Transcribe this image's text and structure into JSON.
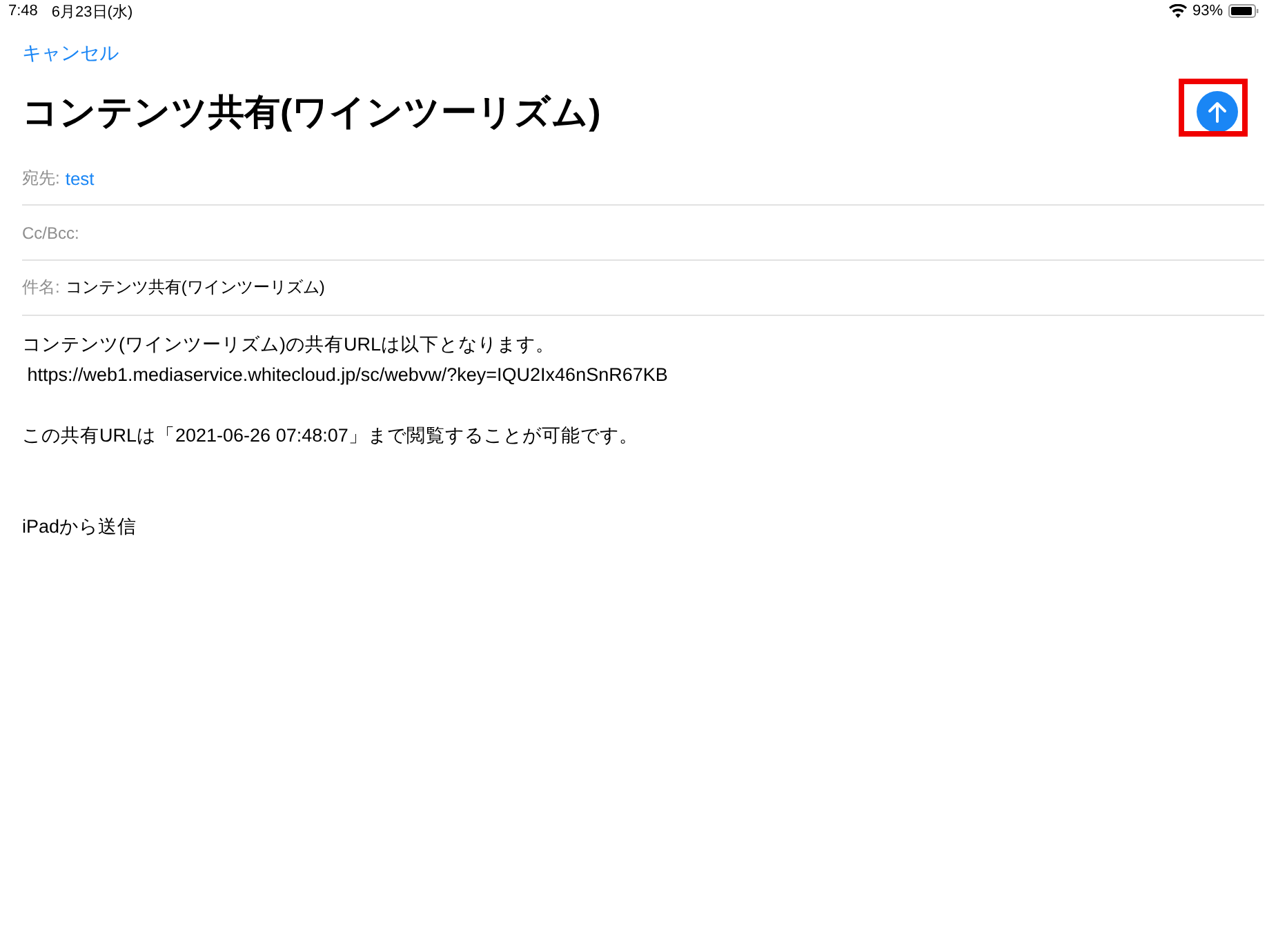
{
  "status_bar": {
    "time": "7:48",
    "date": "6月23日(水)",
    "battery_percent": "93%"
  },
  "nav": {
    "cancel": "キャンセル"
  },
  "title": "コンテンツ共有(ワインツーリズム)",
  "send_button": {
    "highlighted": true
  },
  "fields": [
    {
      "label": "宛先:",
      "value": "test",
      "kind": "recipient"
    },
    {
      "label": "Cc/Bcc:",
      "kind": "recipient"
    },
    {
      "label": "件名:",
      "value": "コンテンツ共有(ワインツーリズム)",
      "kind": "subject"
    }
  ],
  "body": [
    {
      "kind": "paragraph",
      "lines": [
        "コンテンツ(ワインツーリズム)の共有URLは以下となります。",
        " https://web1.mediaservice.whitecloud.jp/sc/webvw/?key=IQU2Ix46nSnR67KB"
      ]
    },
    {
      "kind": "paragraph",
      "lines": [
        "この共有URLは「2021-06-26 07:48:07」まで閲覧することが可能です。"
      ]
    },
    {
      "kind": "signature",
      "lines": [
        "iPadから送信"
      ]
    }
  ]
}
